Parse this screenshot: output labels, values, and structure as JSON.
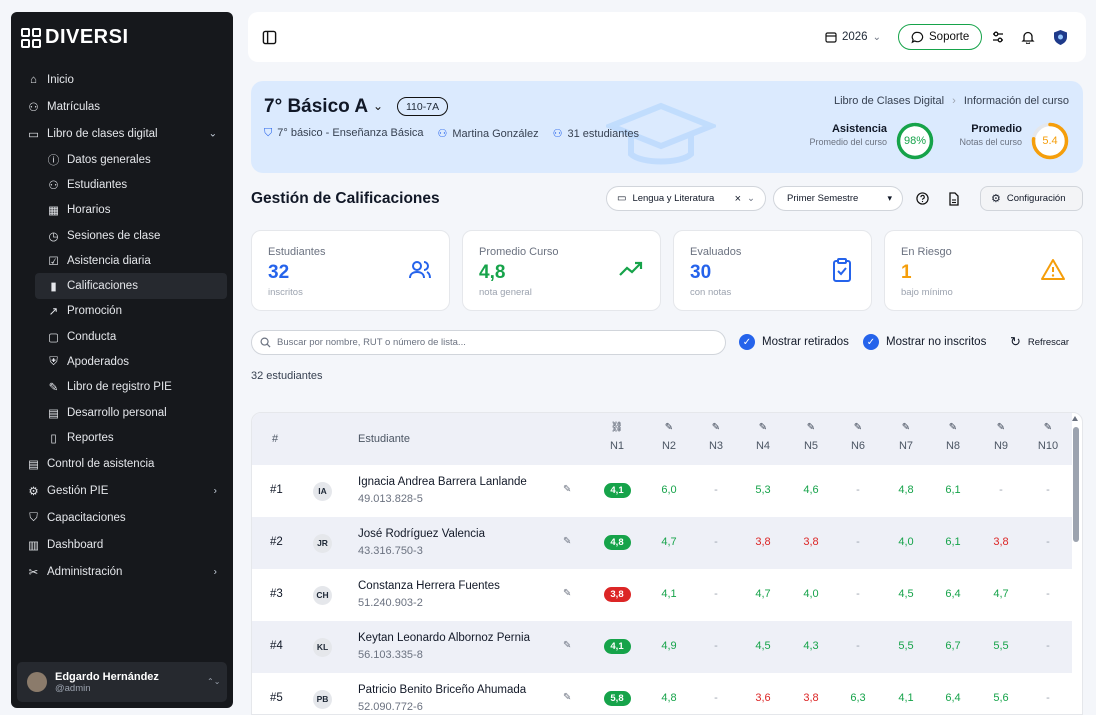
{
  "brand": {
    "name": "DIVERSI"
  },
  "sidebar": {
    "items": [
      {
        "label": "Inicio",
        "icon": "home-icon",
        "glyph": "⌂"
      },
      {
        "label": "Matrículas",
        "icon": "user-plus-icon",
        "glyph": "⚇"
      },
      {
        "label": "Libro de clases digital",
        "icon": "book-icon",
        "glyph": "▭",
        "chevron": "⌄"
      },
      {
        "label": "Datos generales",
        "icon": "info-icon",
        "glyph": "ⓘ",
        "sub": true
      },
      {
        "label": "Estudiantes",
        "icon": "users-icon",
        "glyph": "⚇",
        "sub": true
      },
      {
        "label": "Horarios",
        "icon": "calendar-icon",
        "glyph": "▦",
        "sub": true
      },
      {
        "label": "Sesiones de clase",
        "icon": "clock-icon",
        "glyph": "◷",
        "sub": true
      },
      {
        "label": "Asistencia diaria",
        "icon": "check-square-icon",
        "glyph": "☑",
        "sub": true
      },
      {
        "label": "Calificaciones",
        "icon": "bar-chart-icon",
        "glyph": "▮",
        "sub": true,
        "active": true
      },
      {
        "label": "Promoción",
        "icon": "trend-icon",
        "glyph": "↗",
        "sub": true
      },
      {
        "label": "Conducta",
        "icon": "chat-icon",
        "glyph": "▢",
        "sub": true
      },
      {
        "label": "Apoderados",
        "icon": "shield-icon",
        "glyph": "⛨",
        "sub": true
      },
      {
        "label": "Libro de registro PIE",
        "icon": "edit-icon",
        "glyph": "✎",
        "sub": true
      },
      {
        "label": "Desarrollo personal",
        "icon": "clipboard-icon",
        "glyph": "▤",
        "sub": true
      },
      {
        "label": "Reportes",
        "icon": "file-icon",
        "glyph": "▯",
        "sub": true
      },
      {
        "label": "Control de asistencia",
        "icon": "clipboard-check-icon",
        "glyph": "▤"
      },
      {
        "label": "Gestión PIE",
        "icon": "gear-icon",
        "glyph": "⚙",
        "chevron": "›"
      },
      {
        "label": "Capacitaciones",
        "icon": "graduation-icon",
        "glyph": "⛉"
      },
      {
        "label": "Dashboard",
        "icon": "chart-icon",
        "glyph": "▥"
      },
      {
        "label": "Administración",
        "icon": "wrench-icon",
        "glyph": "✂",
        "chevron": "›"
      }
    ],
    "user": {
      "name": "Edgardo Hernández",
      "handle": "@admin",
      "chevron": "⌃⌄"
    }
  },
  "topbar": {
    "year": "2026",
    "support": "Soporte",
    "chev": "⌄"
  },
  "course": {
    "title": "7° Básico A",
    "code": "110-7A",
    "level": "7° básico - Enseñanza Básica",
    "teacher": "Martina González",
    "students": "31 estudiantes",
    "breadcrumb": [
      "Libro de Clases Digital",
      "Información del curso"
    ],
    "sep": "›",
    "chev": "⌄",
    "attendance": {
      "label": "Asistencia",
      "sub": "Promedio del curso",
      "value": "98%",
      "pct": 98,
      "color": "#16a34a"
    },
    "average": {
      "label": "Promedio",
      "sub": "Notas del curso",
      "value": "5.4",
      "pct": 77,
      "color": "#f59e0b"
    }
  },
  "section": {
    "title": "Gestión de Calificaciones",
    "subject": "Lengua y Literatura",
    "clear": "×",
    "chev": "⌄",
    "semester": "Primer Semestre",
    "caret": "▾",
    "config": "Configuración"
  },
  "cards": [
    {
      "label": "Estudiantes",
      "value": "32",
      "sub": "inscritos",
      "color": "#2563eb",
      "icon": "users-icon"
    },
    {
      "label": "Promedio Curso",
      "value": "4,8",
      "sub": "nota general",
      "color": "#16a34a",
      "icon": "trend-up-icon"
    },
    {
      "label": "Evaluados",
      "value": "30",
      "sub": "con notas",
      "color": "#2563eb",
      "icon": "clipboard-check-icon"
    },
    {
      "label": "En Riesgo",
      "value": "1",
      "sub": "bajo mínimo",
      "color": "#f59e0b",
      "icon": "warning-icon"
    }
  ],
  "filters": {
    "search_placeholder": "Buscar por nombre, RUT o número de lista...",
    "show_withdrawn": "Mostrar retirados",
    "show_not_enrolled": "Mostrar no inscritos",
    "refresh": "Refrescar",
    "check": "✓"
  },
  "count": "32 estudiantes",
  "table": {
    "headers": {
      "num": "#",
      "student": "Estudiante",
      "cols": [
        "N1",
        "N2",
        "N3",
        "N4",
        "N5",
        "N6",
        "N7",
        "N8",
        "N9",
        "N10"
      ]
    },
    "rows": [
      {
        "num": "#1",
        "initials": "IA",
        "name": "Ignacia Andrea Barrera Lanlande",
        "rut": "49.013.828-5",
        "grades": [
          "4,1",
          "6,0",
          "-",
          "5,3",
          "4,6",
          "-",
          "4,8",
          "6,1",
          "-",
          "-"
        ]
      },
      {
        "num": "#2",
        "initials": "JR",
        "name": "José Rodríguez Valencia",
        "rut": "43.316.750-3",
        "grades": [
          "4,8",
          "4,7",
          "-",
          "3,8",
          "3,8",
          "-",
          "4,0",
          "6,1",
          "3,8",
          "-"
        ]
      },
      {
        "num": "#3",
        "initials": "CH",
        "name": "Constanza Herrera Fuentes",
        "rut": "51.240.903-2",
        "grades": [
          "3,8",
          "4,1",
          "-",
          "4,7",
          "4,0",
          "-",
          "4,5",
          "6,4",
          "4,7",
          "-"
        ]
      },
      {
        "num": "#4",
        "initials": "KL",
        "name": "Keytan Leonardo Albornoz Pernia",
        "rut": "56.103.335-8",
        "grades": [
          "4,1",
          "4,9",
          "-",
          "4,5",
          "4,3",
          "-",
          "5,5",
          "6,7",
          "5,5",
          "-"
        ]
      },
      {
        "num": "#5",
        "initials": "PB",
        "name": "Patricio Benito Briceño Ahumada",
        "rut": "52.090.772-6",
        "grades": [
          "5,8",
          "4,8",
          "-",
          "3,6",
          "3,8",
          "6,3",
          "4,1",
          "6,4",
          "5,6",
          "-"
        ]
      }
    ]
  }
}
